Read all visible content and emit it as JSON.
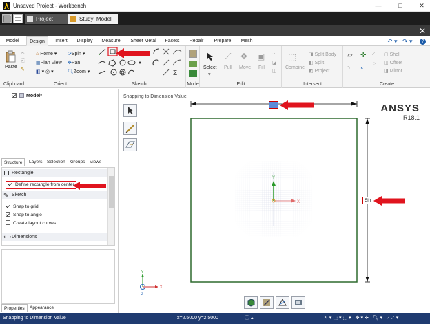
{
  "window": {
    "title": "Unsaved Project - Workbench",
    "minimize": "—",
    "maximize": "□",
    "close": "✕"
  },
  "project_tabs": [
    {
      "label": "Project"
    },
    {
      "label": "Study: Model"
    }
  ],
  "ribbon_tabs": [
    "Model",
    "Design",
    "Insert",
    "Display",
    "Measure",
    "Sheet Metal",
    "Facets",
    "Repair",
    "Prepare",
    "Mesh"
  ],
  "active_ribbon_tab": "Design",
  "qat": {
    "undo": "↶ ▾",
    "redo": "↷ ▾",
    "help": "?"
  },
  "ribbon": {
    "clipboard": {
      "label": "Clipboard",
      "paste": "Paste"
    },
    "orient": {
      "label": "Orient",
      "home": "Home",
      "spin": "Spin",
      "plan_view": "Plan View",
      "pan": "Pan",
      "zoom": "Zoom"
    },
    "sketch": {
      "label": "Sketch"
    },
    "mode": {
      "label": "Mode"
    },
    "edit": {
      "label": "Edit",
      "select": "Select",
      "pull": "Pull",
      "move": "Move",
      "fill": "Fill"
    },
    "intersect": {
      "label": "Intersect",
      "combine": "Combine",
      "split_body": "Split Body",
      "split": "Split",
      "project": "Project"
    },
    "create": {
      "label": "Create",
      "shell": "Shell",
      "offset": "Offset",
      "mirror": "Mirror"
    }
  },
  "tree": {
    "root": "Model*"
  },
  "panel_tabs": [
    "Structure",
    "Layers",
    "Selection",
    "Groups",
    "Views"
  ],
  "options": {
    "rectangle_header": "Rectangle",
    "define_from_center": "Define rectangle from center",
    "sketch_header": "Sketch",
    "snap_grid": "Snap to grid",
    "snap_angle": "Snap to angle",
    "layout_curves": "Create layout curves",
    "dimensions_header": "Dimensions"
  },
  "bottom_tabs": [
    "Properties",
    "Appearance"
  ],
  "viewport": {
    "hint": "Snapping to Dimension Value",
    "brand": "ANSYS",
    "version": "R18.1",
    "dim_vertical": "5in",
    "axis_x": "X",
    "axis_y": "Y",
    "axis_z": "Z"
  },
  "status": {
    "message": "Snapping to Dimension Value",
    "coords": "x=2.5000  y=2.5000",
    "info": "ⓘ ▴"
  },
  "colors": {
    "accent_red": "#e0141e",
    "status_bar": "#1f3b70",
    "sketch_green": "#2e6a2e"
  }
}
